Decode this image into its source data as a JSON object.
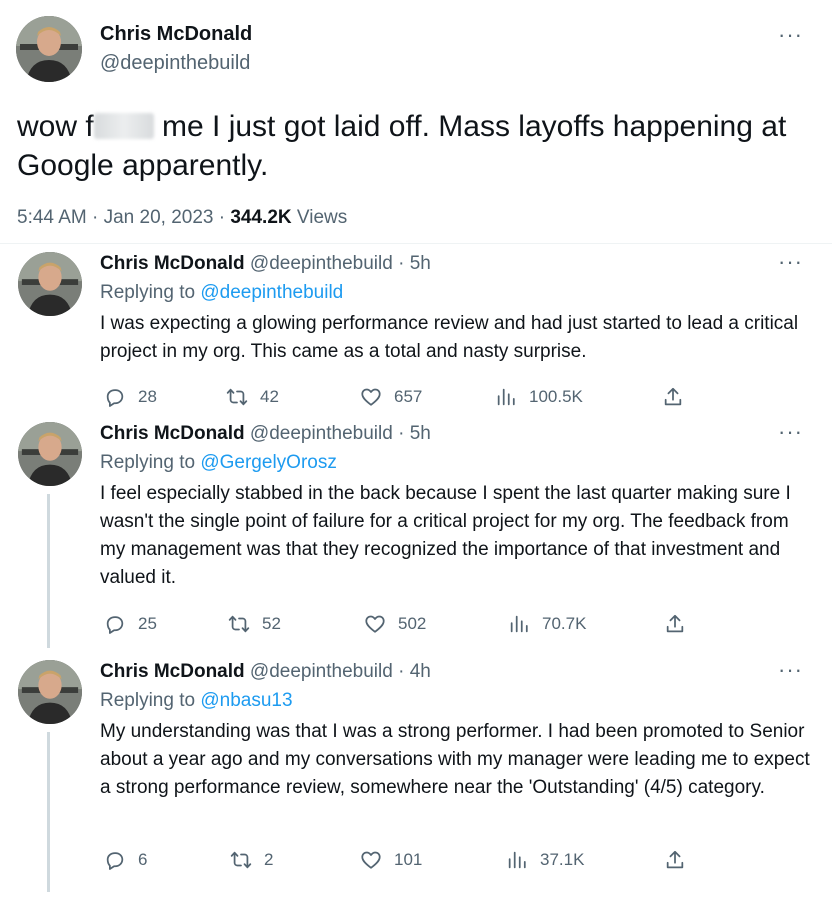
{
  "main": {
    "name": "Chris McDonald",
    "handle": "@deepinthebuild",
    "text_before": "wow f",
    "text_after": " me I just got laid off. Mass layoffs happening at Google apparently.",
    "time": "5:44 AM · Jan 20, 2023 · ",
    "views_count": "344.2K",
    "views_label": " Views",
    "more": "···"
  },
  "replies": [
    {
      "name": "Chris McDonald",
      "handle": "@deepinthebuild",
      "sep": " · ",
      "time": "5h",
      "replying_prefix": "Replying to ",
      "replying_to": "@deepinthebuild",
      "text": "I was expecting a glowing performance review and had just started to lead a critical project in my org. This came as a total and nasty surprise.",
      "replies": "28",
      "retweets": "42",
      "likes": "657",
      "views": "100.5K"
    },
    {
      "name": "Chris McDonald",
      "handle": "@deepinthebuild",
      "sep": " · ",
      "time": "5h",
      "replying_prefix": "Replying to ",
      "replying_to": "@GergelyOrosz",
      "text": "I feel especially stabbed in the back because I spent the last quarter making sure I wasn't the single point of failure for a critical project for my org. The feedback from my management was that they recognized the importance of that investment and valued it.",
      "replies": "25",
      "retweets": "52",
      "likes": "502",
      "views": "70.7K"
    },
    {
      "name": "Chris McDonald",
      "handle": "@deepinthebuild",
      "sep": " · ",
      "time": "4h",
      "replying_prefix": "Replying to ",
      "replying_to": "@nbasu13",
      "text": "My understanding was that I was a strong performer. I had been promoted to Senior about a year ago and my conversations with my manager were leading me to expect a strong performance review, somewhere near the 'Outstanding' (4/5) category.",
      "replies": "6",
      "retweets": "2",
      "likes": "101",
      "views": "37.1K"
    }
  ],
  "icons": {
    "reply": "reply-icon",
    "retweet": "retweet-icon",
    "like": "heart-icon",
    "views": "views-icon",
    "share": "share-icon",
    "more": "more-icon"
  },
  "colors": {
    "accent": "#1d9bf0",
    "muted": "#536471",
    "text": "#0f1419"
  }
}
